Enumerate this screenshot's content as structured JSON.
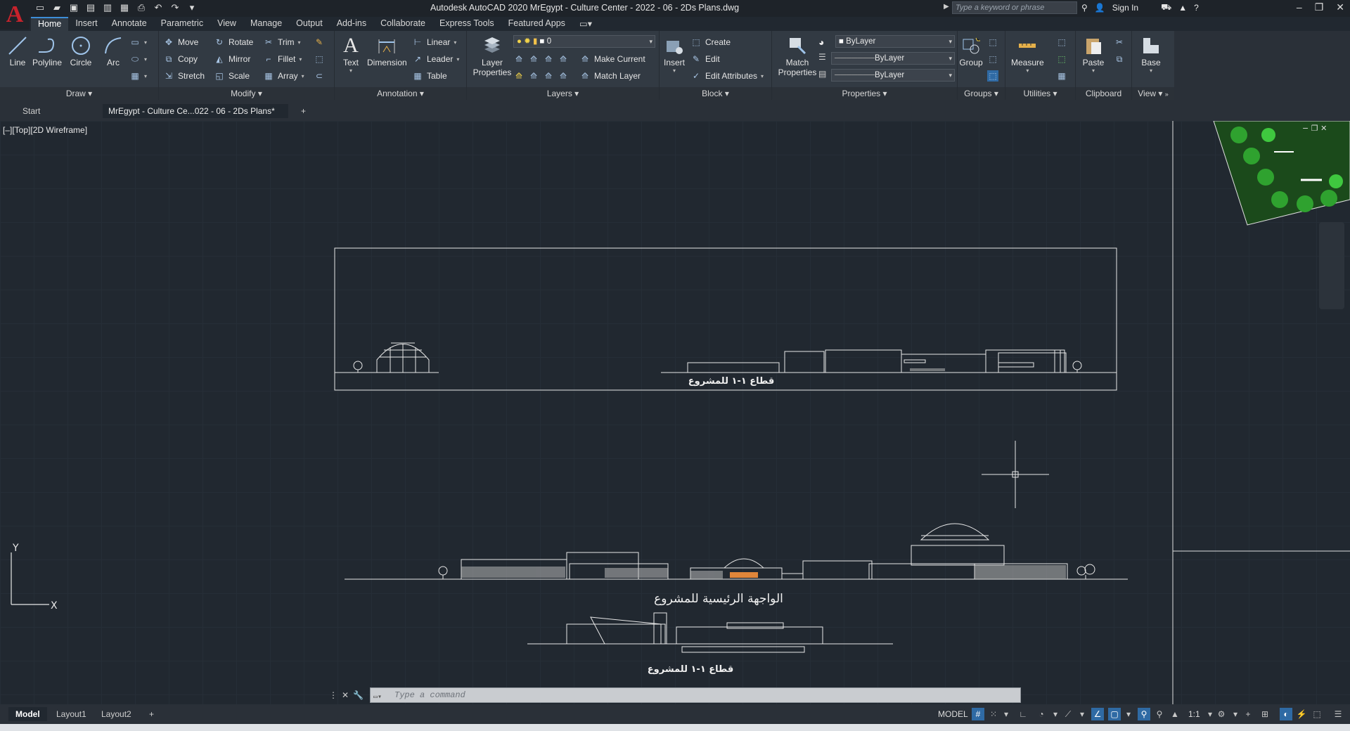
{
  "app": {
    "logo_letter": "A",
    "title": "Autodesk AutoCAD 2020   MrEgypt - Culture Center - 2022 - 06 - 2Ds Plans.dwg",
    "search_placeholder": "Type a keyword or phrase",
    "sign_in": "Sign In",
    "win_min": "–",
    "win_max": "❐",
    "win_close": "✕"
  },
  "ribbon_tabs": [
    "Home",
    "Insert",
    "Annotate",
    "Parametric",
    "View",
    "Manage",
    "Output",
    "Add-ins",
    "Collaborate",
    "Express Tools",
    "Featured Apps"
  ],
  "draw": {
    "title": "Draw ▾",
    "line": "Line",
    "polyline": "Polyline",
    "circle": "Circle",
    "arc": "Arc"
  },
  "modify": {
    "title": "Modify ▾",
    "move": "Move",
    "rotate": "Rotate",
    "trim": "Trim",
    "copy": "Copy",
    "mirror": "Mirror",
    "fillet": "Fillet",
    "stretch": "Stretch",
    "scale": "Scale",
    "array": "Array"
  },
  "annotation": {
    "title": "Annotation ▾",
    "text": "Text",
    "dimension": "Dimension",
    "linear": "Linear",
    "leader": "Leader",
    "table": "Table"
  },
  "layers": {
    "title": "Layers ▾",
    "layer_properties": "Layer Properties",
    "current_layer": "0",
    "make_current": "Make Current",
    "match_layer": "Match Layer"
  },
  "block": {
    "title": "Block ▾",
    "insert": "Insert",
    "create": "Create",
    "edit": "Edit",
    "edit_attributes": "Edit Attributes"
  },
  "properties": {
    "title": "Properties ▾",
    "match_properties": "Match Properties",
    "color": "ByLayer",
    "linetype": "ByLayer",
    "lineweight": "ByLayer"
  },
  "groups": {
    "title": "Groups ▾",
    "group": "Group"
  },
  "utilities": {
    "title": "Utilities ▾",
    "measure": "Measure"
  },
  "clipboard": {
    "title": "Clipboard",
    "paste": "Paste"
  },
  "view": {
    "title": "View ▾",
    "base": "Base"
  },
  "file_tabs": {
    "start": "Start",
    "active": "MrEgypt - Culture Ce...022 - 06 - 2Ds Plans*",
    "add": "+"
  },
  "viewport": {
    "label": "[–][Top][2D Wireframe]",
    "ucs_y": "Y",
    "ucs_x": "X"
  },
  "drawing_labels": {
    "section_top": "قطاع ١-١ للمشروع",
    "facade": "الواجهة الرئيسية للمشروع",
    "section_bottom": "قطاع ١-١ للمشروع"
  },
  "command": {
    "placeholder": "Type a command"
  },
  "status": {
    "model_tab": "Model",
    "layout1": "Layout1",
    "layout2": "Layout2",
    "add": "+",
    "model_label": "MODEL",
    "scale": "1:1"
  }
}
